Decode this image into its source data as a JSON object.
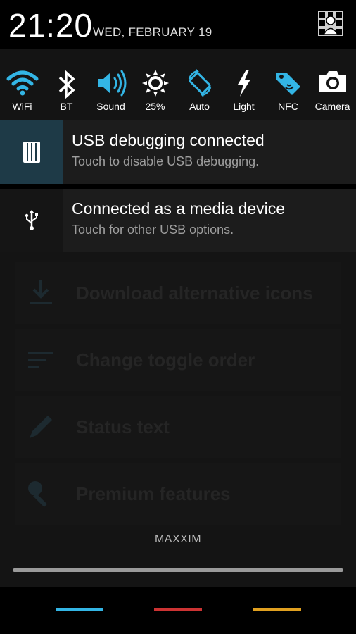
{
  "status": {
    "time": "21:20",
    "date": "WED, FEBRUARY 19"
  },
  "toggles": [
    {
      "label": "WiFi",
      "icon": "wifi-icon",
      "color": "#33b5e5"
    },
    {
      "label": "BT",
      "icon": "bluetooth-icon",
      "color": "#ffffff"
    },
    {
      "label": "Sound",
      "icon": "sound-icon",
      "color": "#33b5e5"
    },
    {
      "label": "25%",
      "icon": "brightness-icon",
      "color": "#ffffff"
    },
    {
      "label": "Auto",
      "icon": "rotate-icon",
      "color": "#33b5e5"
    },
    {
      "label": "Light",
      "icon": "flashlight-icon",
      "color": "#ffffff"
    },
    {
      "label": "NFC",
      "icon": "nfc-icon",
      "color": "#33b5e5"
    },
    {
      "label": "Camera",
      "icon": "camera-icon",
      "color": "#ffffff"
    }
  ],
  "notifications": [
    {
      "title": "USB debugging connected",
      "subtitle": "Touch to disable USB debugging."
    },
    {
      "title": "Connected as a media device",
      "subtitle": "Touch for other USB options."
    }
  ],
  "background_app": {
    "items": [
      {
        "label": "Download alternative icons",
        "icon": "download-icon"
      },
      {
        "label": "Change toggle order",
        "icon": "sort-icon"
      },
      {
        "label": "Status text",
        "icon": "pencil-icon"
      },
      {
        "label": "Premium features",
        "icon": "key-icon"
      }
    ]
  },
  "carrier": "MAXXIM",
  "navbar": {
    "colors": [
      "#33b5e5",
      "#cc3333",
      "#e0a020"
    ]
  }
}
